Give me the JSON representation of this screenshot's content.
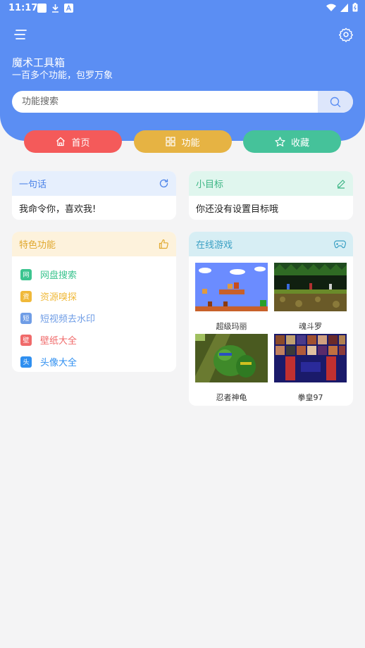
{
  "status_bar": {
    "time": "11:17"
  },
  "header": {
    "app_title": "魔术工具箱",
    "app_subtitle": "一百多个功能，包罗万象",
    "search_placeholder": "功能搜索"
  },
  "tabs": [
    {
      "label": "首页",
      "icon": "home-icon",
      "color": "#f45a5a"
    },
    {
      "label": "功能",
      "icon": "grid-icon",
      "color": "#e6b343"
    },
    {
      "label": "收藏",
      "icon": "star-icon",
      "color": "#45c29a"
    }
  ],
  "quote_card": {
    "title": "一句话",
    "text": "我命令你，喜欢我!"
  },
  "goal_card": {
    "title": "小目标",
    "text": "你还没有设置目标哦"
  },
  "features_card": {
    "title": "特色功能",
    "items": [
      {
        "badge": "网",
        "label": "网盘搜索",
        "color": "#3cc48f"
      },
      {
        "badge": "资",
        "label": "资源嗅探",
        "color": "#f0b93a"
      },
      {
        "badge": "短",
        "label": "短视频去水印",
        "color": "#6f9de6"
      },
      {
        "badge": "壁",
        "label": "壁纸大全",
        "color": "#f06a6a"
      },
      {
        "badge": "头",
        "label": "头像大全",
        "color": "#2f8ff0"
      }
    ]
  },
  "games_card": {
    "title": "在线游戏",
    "games": [
      {
        "name": "超级玛丽"
      },
      {
        "name": "魂斗罗"
      },
      {
        "name": "忍者神龟"
      },
      {
        "name": "拳皇97"
      }
    ]
  },
  "colors": {
    "primary": "#5b8ef3",
    "background": "#f4f4f5"
  }
}
